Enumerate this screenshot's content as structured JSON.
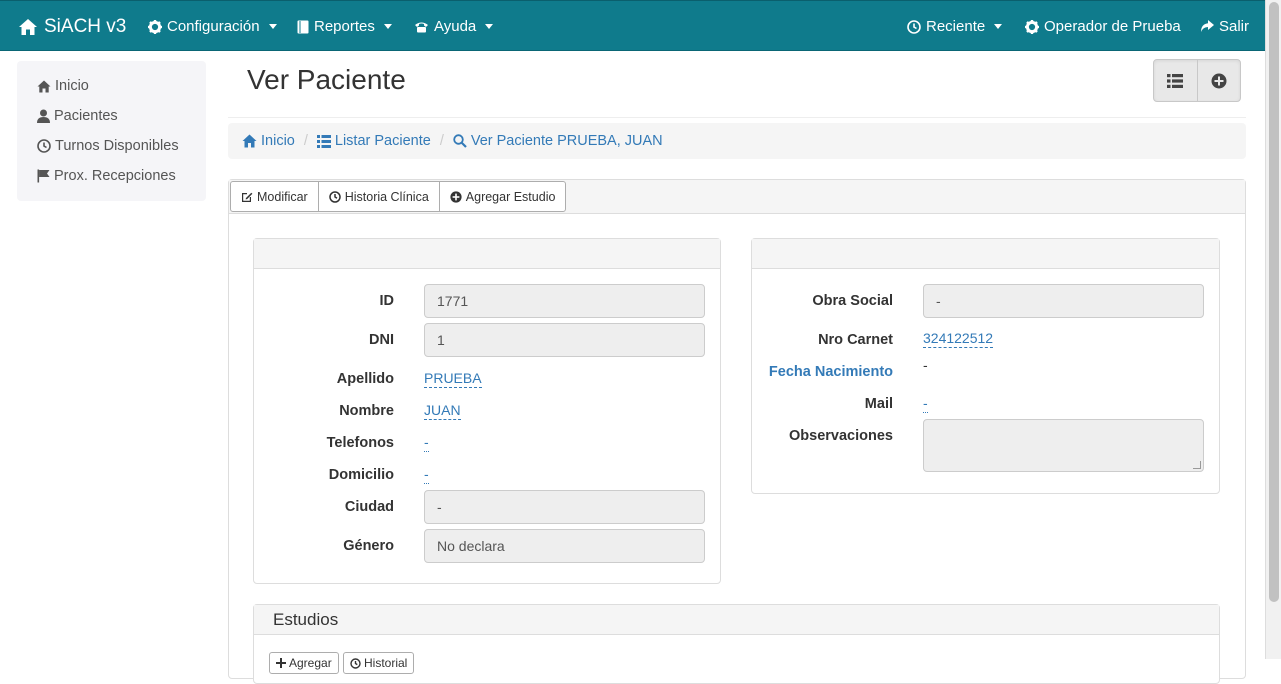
{
  "colors": {
    "navbar": "#0f7b8c",
    "link": "#337ab7"
  },
  "navbar": {
    "brand": "SiACH v3",
    "brand_icon": "home-icon",
    "menus": [
      {
        "label": "Configuración",
        "icon": "gear-icon"
      },
      {
        "label": "Reportes",
        "icon": "book-icon"
      },
      {
        "label": "Ayuda",
        "icon": "phone-icon"
      }
    ],
    "recent": {
      "label": "Reciente",
      "icon": "clock-icon"
    },
    "user": {
      "label": "Operador de Prueba",
      "icon": "gear-icon"
    },
    "logout": {
      "label": "Salir",
      "icon": "share-icon"
    }
  },
  "sidebar": {
    "items": [
      {
        "label": "Inicio",
        "icon": "home-icon"
      },
      {
        "label": "Pacientes",
        "icon": "user-icon"
      },
      {
        "label": "Turnos Disponibles",
        "icon": "clock-icon"
      },
      {
        "label": "Prox. Recepciones",
        "icon": "flag-icon"
      }
    ]
  },
  "page": {
    "title": "Ver Paciente"
  },
  "title_buttons": [
    {
      "icon": "list-icon"
    },
    {
      "icon": "plus-circle-icon"
    }
  ],
  "breadcrumb": [
    {
      "label": "Inicio",
      "icon": "home-icon"
    },
    {
      "label": "Listar Paciente",
      "icon": "list-icon"
    },
    {
      "label": "Ver Paciente PRUEBA, JUAN",
      "icon": "search-icon"
    }
  ],
  "toolbar": {
    "modificar": "Modificar",
    "historia": "Historia Clínica",
    "agregar": "Agregar Estudio"
  },
  "patient_left": {
    "id_label": "ID",
    "id_value": "1771",
    "dni_label": "DNI",
    "dni_value": "1",
    "apellido_label": "Apellido",
    "apellido_value": "PRUEBA",
    "nombre_label": "Nombre",
    "nombre_value": "JUAN",
    "telefonos_label": "Telefonos",
    "telefonos_value": "-",
    "domicilio_label": "Domicilio",
    "domicilio_value": "-",
    "ciudad_label": "Ciudad",
    "ciudad_value": "-",
    "genero_label": "Género",
    "genero_value": "No declara"
  },
  "patient_right": {
    "obra_label": "Obra Social",
    "obra_value": "-",
    "carnet_label": "Nro Carnet",
    "carnet_value": "324122512",
    "nacimiento_label": "Fecha Nacimiento",
    "nacimiento_value": "-",
    "mail_label": "Mail",
    "mail_value": "-",
    "observaciones_label": "Observaciones",
    "observaciones_value": ""
  },
  "estudios": {
    "title": "Estudios",
    "btn_agregar": "Agregar",
    "btn_historial": "Historial"
  }
}
